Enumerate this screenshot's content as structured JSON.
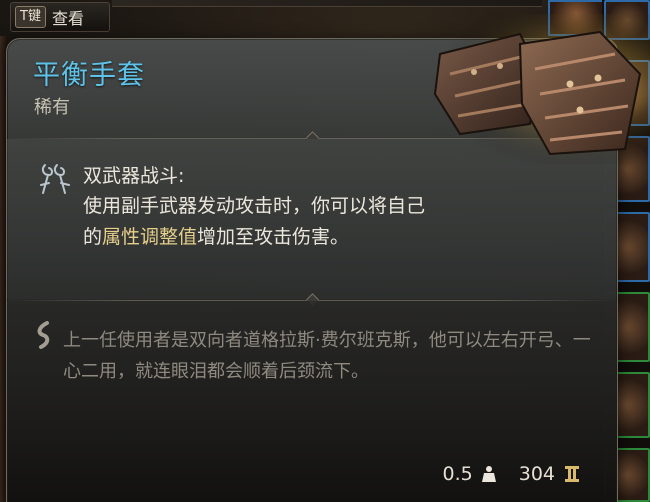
{
  "hint": {
    "key": "T键",
    "label": "查看"
  },
  "item": {
    "name": "平衡手套",
    "rarity": "稀有",
    "name_color": "#5ec3ea"
  },
  "effect": {
    "icon": "dual-wield-icon",
    "title": "双武器战斗:",
    "body_before": "使用副手武器发动攻击时，你可以将自己的",
    "body_highlight": "属性调整值",
    "body_after": "增加至攻击伤害。",
    "highlight_color": "#e6cf8a"
  },
  "lore": {
    "icon": "quill-icon",
    "text": "上一任使用者是双向者道格拉斯·费尔班克斯，他可以左右开弓、一心二用，就连眼泪都会顺着后颈流下。"
  },
  "stats": {
    "weight": "0.5",
    "weight_icon": "weight-icon",
    "value": "304",
    "value_icon": "gold-coin-icon"
  }
}
